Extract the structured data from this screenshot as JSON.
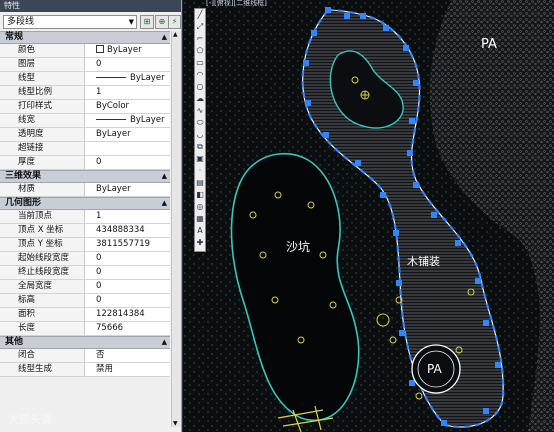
{
  "panel": {
    "title": "特性",
    "object_type": "多段线",
    "sections": [
      {
        "title": "常规",
        "key": "general",
        "rows": [
          {
            "label": "颜色",
            "value": "ByLayer",
            "kind": "color"
          },
          {
            "label": "图层",
            "value": "0"
          },
          {
            "label": "线型",
            "value": "ByLayer",
            "kind": "line"
          },
          {
            "label": "线型比例",
            "value": "1"
          },
          {
            "label": "打印样式",
            "value": "ByColor"
          },
          {
            "label": "线宽",
            "value": "ByLayer",
            "kind": "line"
          },
          {
            "label": "透明度",
            "value": "ByLayer"
          },
          {
            "label": "超链接",
            "value": ""
          },
          {
            "label": "厚度",
            "value": "0"
          }
        ]
      },
      {
        "title": "三维效果",
        "key": "3d",
        "rows": [
          {
            "label": "材质",
            "value": "ByLayer"
          }
        ]
      },
      {
        "title": "几何图形",
        "key": "geometry",
        "rows": [
          {
            "label": "当前顶点",
            "value": "1"
          },
          {
            "label": "顶点 X 坐标",
            "value": "434888334"
          },
          {
            "label": "顶点 Y 坐标",
            "value": "3811557719"
          },
          {
            "label": "起始线段宽度",
            "value": "0"
          },
          {
            "label": "终止线段宽度",
            "value": "0"
          },
          {
            "label": "全局宽度",
            "value": "0"
          },
          {
            "label": "标高",
            "value": "0"
          },
          {
            "label": "面积",
            "value": "122814384"
          },
          {
            "label": "长度",
            "value": "75666"
          }
        ]
      },
      {
        "title": "其他",
        "key": "misc",
        "rows": [
          {
            "label": "闭合",
            "value": "否"
          },
          {
            "label": "线型生成",
            "value": "禁用"
          }
        ]
      }
    ]
  },
  "canvas": {
    "tab_label": "[-][俯视][二维线框]",
    "labels": {
      "pa_top": "PA",
      "pa_circle": "PA",
      "sandpit": "沙坑",
      "deck": "木铺装"
    },
    "colors": {
      "background": "#0b0d10",
      "selection": "#2f86ff",
      "outline": "#ffffff",
      "sand_edge": "#35c7c0"
    }
  },
  "watermark": "大部头说"
}
